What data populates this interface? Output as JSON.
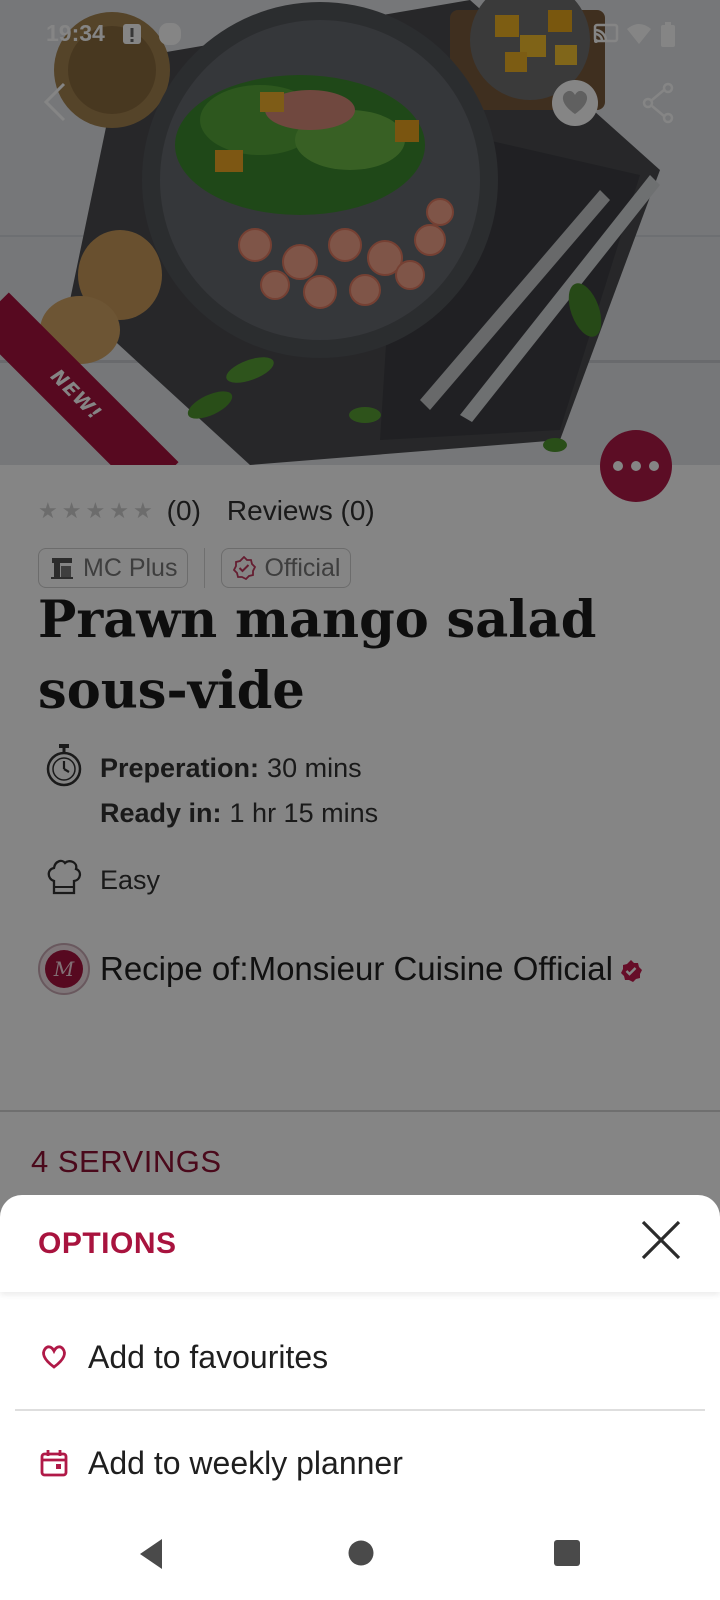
{
  "status_bar": {
    "time": "19:34"
  },
  "hero": {
    "ribbon_text": "NEW!"
  },
  "recipe": {
    "rating_count": "(0)",
    "reviews_label": "Reviews (0)",
    "badges": [
      {
        "label": "MC Plus",
        "icon": "machine-icon"
      },
      {
        "label": "Official",
        "icon": "official-check-icon"
      }
    ],
    "title_line1": "Prawn mango salad",
    "title_line2": "sous-vide",
    "preparation_label": "Preperation:",
    "preparation_value": "30 mins",
    "ready_label": "Ready in:",
    "ready_value": "1 hr 15 mins",
    "difficulty": "Easy",
    "author": "Recipe of:Monsieur Cuisine Official",
    "author_avatar_letter": "M",
    "servings": "4 SERVINGS"
  },
  "options_sheet": {
    "title": "OPTIONS",
    "items": [
      {
        "label": "Add to favourites",
        "icon": "heart-icon"
      },
      {
        "label": "Add to weekly planner",
        "icon": "calendar-icon"
      }
    ]
  },
  "colors": {
    "brand": "#a8133e",
    "scrim": "rgba(0,0,0,0.48)"
  }
}
